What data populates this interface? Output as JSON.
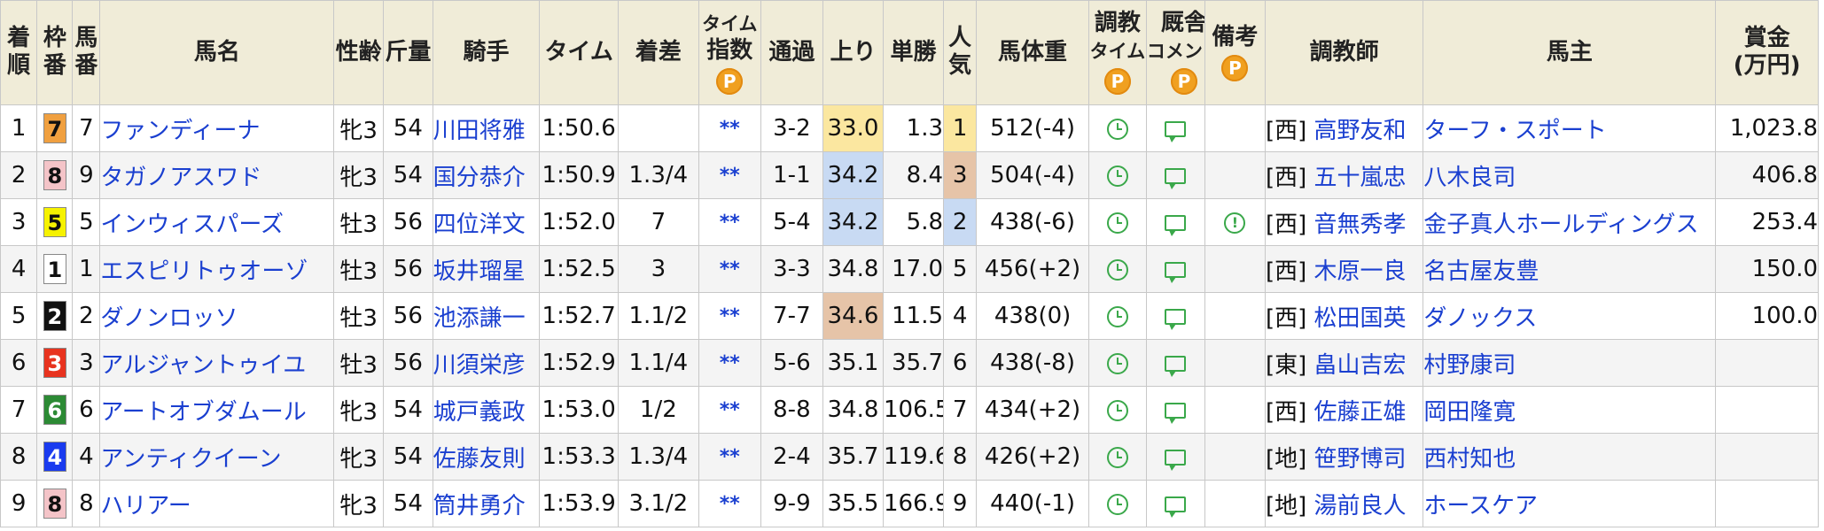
{
  "header": {
    "finish": [
      "着",
      "順"
    ],
    "frame": [
      "枠",
      "番"
    ],
    "horse_no": [
      "馬",
      "番"
    ],
    "horse_name": "馬名",
    "sex_age": "性齢",
    "weight": "斤量",
    "jockey": "騎手",
    "time": "タイム",
    "margin": "着差",
    "time_index": [
      "タイム",
      "指数"
    ],
    "passing": "通過",
    "last3f": "上り",
    "odds": "単勝",
    "popularity": [
      "人",
      "気"
    ],
    "body_weight": "馬体重",
    "training_time": [
      "調教",
      "タイム"
    ],
    "stable_comment": [
      "厩舎",
      "コメント"
    ],
    "remarks": "備考",
    "trainer": "調教師",
    "owner": "馬主",
    "prize": [
      "賞金",
      "(万円)"
    ],
    "premium_mark": "P"
  },
  "colors": {
    "frame_1": "#ffffff",
    "frame_2": "#111111",
    "frame_3": "#e8331f",
    "frame_4": "#1a3bef",
    "frame_5": "#f6f200",
    "frame_6": "#2c8a34",
    "frame_7": "#f0a040",
    "frame_8": "#f4c4c8",
    "last3f_rank1": "#fbe7a0",
    "last3f_rank2": "#c8daf3",
    "last3f_rank3": "#e6c4a8",
    "pop_1": "#fbe7a0",
    "pop_2": "#c8daf3",
    "pop_3": "#e6c4a8",
    "link": "#1a3fd0",
    "icon_green": "#3aa84a"
  },
  "rows": [
    {
      "finish": "1",
      "frame": "7",
      "horse_no": "7",
      "name": "ファンディーナ",
      "sex_age": "牝3",
      "weight": "54",
      "jockey": "川田将雅",
      "time": "1:50.6",
      "margin": "",
      "tindex": "**",
      "passing": "3-2",
      "last3f": "33.0",
      "last3f_rank": 1,
      "odds": "1.3",
      "pop": "1",
      "body": "512(-4)",
      "remark": false,
      "region": "[西]",
      "trainer": "高野友和",
      "owner": "ターフ・スポート",
      "prize": "1,023.8"
    },
    {
      "finish": "2",
      "frame": "8",
      "horse_no": "9",
      "name": "タガノアスワド",
      "sex_age": "牝3",
      "weight": "54",
      "jockey": "国分恭介",
      "time": "1:50.9",
      "margin": "1.3/4",
      "tindex": "**",
      "passing": "1-1",
      "last3f": "34.2",
      "last3f_rank": 2,
      "odds": "8.4",
      "pop": "3",
      "body": "504(-4)",
      "remark": false,
      "region": "[西]",
      "trainer": "五十嵐忠",
      "owner": "八木良司",
      "prize": "406.8"
    },
    {
      "finish": "3",
      "frame": "5",
      "horse_no": "5",
      "name": "インウィスパーズ",
      "sex_age": "牡3",
      "weight": "56",
      "jockey": "四位洋文",
      "time": "1:52.0",
      "margin": "7",
      "tindex": "**",
      "passing": "5-4",
      "last3f": "34.2",
      "last3f_rank": 2,
      "odds": "5.8",
      "pop": "2",
      "body": "438(-6)",
      "remark": true,
      "region": "[西]",
      "trainer": "音無秀孝",
      "owner": "金子真人ホールディングス",
      "prize": "253.4"
    },
    {
      "finish": "4",
      "frame": "1",
      "horse_no": "1",
      "name": "エスピリトゥオーゾ",
      "sex_age": "牡3",
      "weight": "56",
      "jockey": "坂井瑠星",
      "time": "1:52.5",
      "margin": "3",
      "tindex": "**",
      "passing": "3-3",
      "last3f": "34.8",
      "last3f_rank": 0,
      "odds": "17.0",
      "pop": "5",
      "body": "456(+2)",
      "remark": false,
      "region": "[西]",
      "trainer": "木原一良",
      "owner": "名古屋友豊",
      "prize": "150.0"
    },
    {
      "finish": "5",
      "frame": "2",
      "horse_no": "2",
      "name": "ダノンロッソ",
      "sex_age": "牡3",
      "weight": "56",
      "jockey": "池添謙一",
      "time": "1:52.7",
      "margin": "1.1/2",
      "tindex": "**",
      "passing": "7-7",
      "last3f": "34.6",
      "last3f_rank": 3,
      "odds": "11.5",
      "pop": "4",
      "body": "438(0)",
      "remark": false,
      "region": "[西]",
      "trainer": "松田国英",
      "owner": "ダノックス",
      "prize": "100.0"
    },
    {
      "finish": "6",
      "frame": "3",
      "horse_no": "3",
      "name": "アルジャントゥイユ",
      "sex_age": "牡3",
      "weight": "56",
      "jockey": "川須栄彦",
      "time": "1:52.9",
      "margin": "1.1/4",
      "tindex": "**",
      "passing": "5-6",
      "last3f": "35.1",
      "last3f_rank": 0,
      "odds": "35.7",
      "pop": "6",
      "body": "438(-8)",
      "remark": false,
      "region": "[東]",
      "trainer": "畠山吉宏",
      "owner": "村野康司",
      "prize": ""
    },
    {
      "finish": "7",
      "frame": "6",
      "horse_no": "6",
      "name": "アートオブダムール",
      "sex_age": "牝3",
      "weight": "54",
      "jockey": "城戸義政",
      "time": "1:53.0",
      "margin": "1/2",
      "tindex": "**",
      "passing": "8-8",
      "last3f": "34.8",
      "last3f_rank": 0,
      "odds": "106.5",
      "pop": "7",
      "body": "434(+2)",
      "remark": false,
      "region": "[西]",
      "trainer": "佐藤正雄",
      "owner": "岡田隆寛",
      "prize": ""
    },
    {
      "finish": "8",
      "frame": "4",
      "horse_no": "4",
      "name": "アンティクイーン",
      "sex_age": "牝3",
      "weight": "54",
      "jockey": "佐藤友則",
      "time": "1:53.3",
      "margin": "1.3/4",
      "tindex": "**",
      "passing": "2-4",
      "last3f": "35.7",
      "last3f_rank": 0,
      "odds": "119.6",
      "pop": "8",
      "body": "426(+2)",
      "remark": false,
      "region": "[地]",
      "trainer": "笹野博司",
      "owner": "西村知也",
      "prize": ""
    },
    {
      "finish": "9",
      "frame": "8",
      "horse_no": "8",
      "name": "ハリアー",
      "sex_age": "牝3",
      "weight": "54",
      "jockey": "筒井勇介",
      "time": "1:53.9",
      "margin": "3.1/2",
      "tindex": "**",
      "passing": "9-9",
      "last3f": "35.5",
      "last3f_rank": 0,
      "odds": "166.9",
      "pop": "9",
      "body": "440(-1)",
      "remark": false,
      "region": "[地]",
      "trainer": "湯前良人",
      "owner": "ホースケア",
      "prize": ""
    }
  ]
}
